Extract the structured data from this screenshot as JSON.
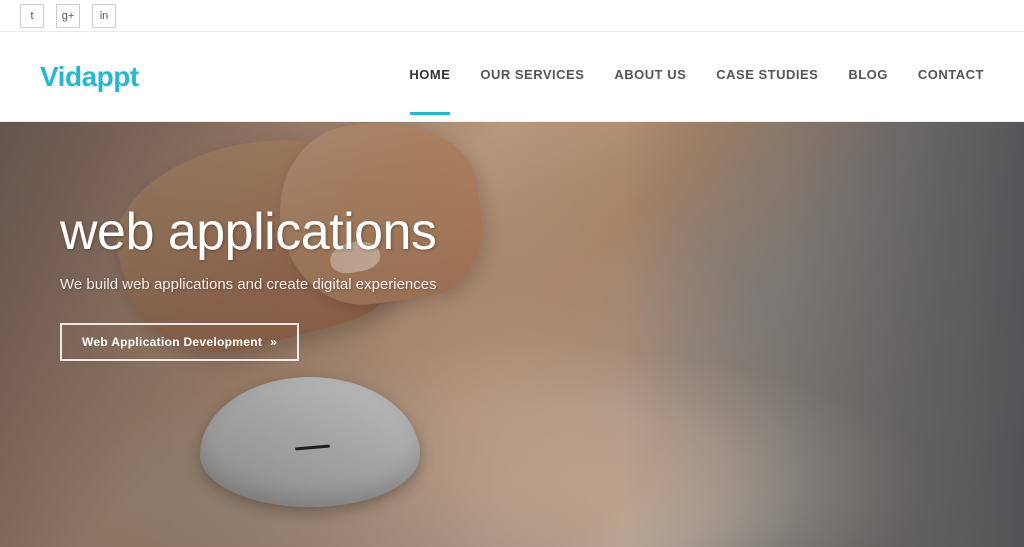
{
  "topBar": {
    "socialIcons": [
      {
        "name": "twitter-icon",
        "label": "t"
      },
      {
        "name": "googleplus-icon",
        "label": "g+"
      },
      {
        "name": "linkedin-icon",
        "label": "in"
      }
    ]
  },
  "header": {
    "logo": {
      "textStart": "Vid",
      "textEnd": "appt"
    },
    "nav": {
      "items": [
        {
          "id": "home",
          "label": "HOME",
          "active": true
        },
        {
          "id": "our-services",
          "label": "OUR SERVICES",
          "active": false
        },
        {
          "id": "about-us",
          "label": "ABOUT US",
          "active": false
        },
        {
          "id": "case-studies",
          "label": "CASE STUDIES",
          "active": false
        },
        {
          "id": "blog",
          "label": "BLOG",
          "active": false
        },
        {
          "id": "contact",
          "label": "CONTACT",
          "active": false
        }
      ]
    }
  },
  "hero": {
    "title": "web applications",
    "subtitle": "We build web applications and create digital experiences",
    "cta": {
      "label": "Web Application Development",
      "arrow": "»"
    }
  }
}
